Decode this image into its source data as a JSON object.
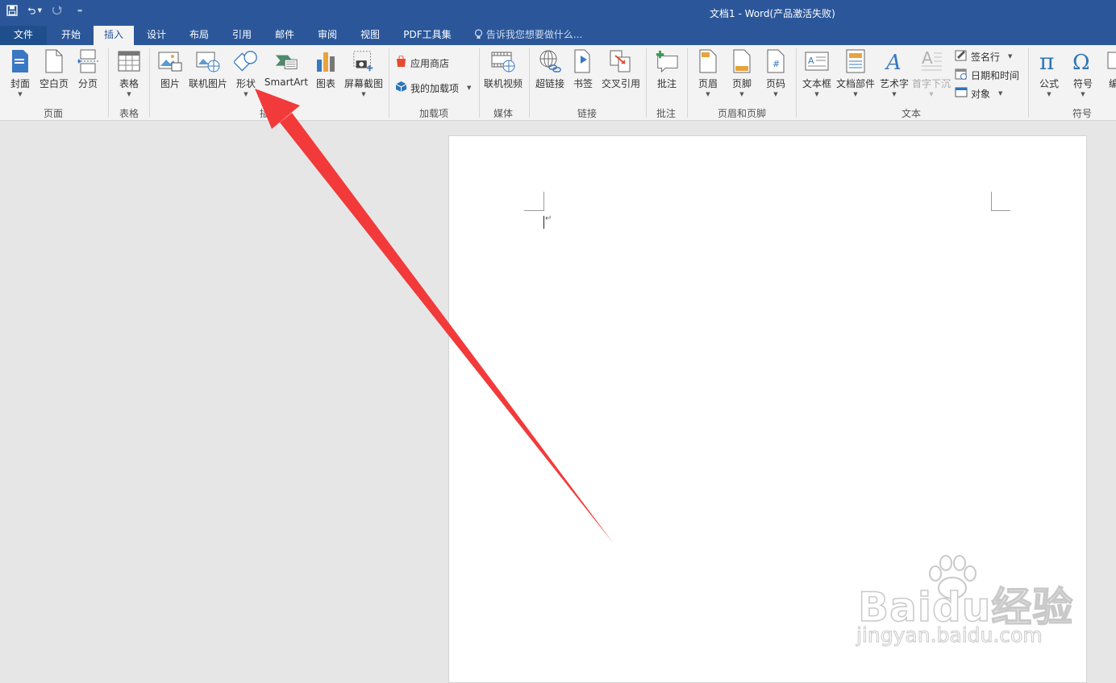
{
  "window": {
    "title": "文档1 - Word(产品激活失败)"
  },
  "qat": {
    "save_icon": "save-icon",
    "undo_icon": "undo-icon",
    "redo_icon": "redo-icon",
    "customize_icon": "customize-qat-icon"
  },
  "tabs": {
    "file": "文件",
    "home": "开始",
    "insert": "插入",
    "design": "设计",
    "layout": "布局",
    "references": "引用",
    "mailings": "邮件",
    "review": "审阅",
    "view": "视图",
    "pdf": "PDF工具集"
  },
  "tellme": {
    "placeholder": "告诉我您想要做什么..."
  },
  "ribbon": {
    "pages": {
      "cover": "封面",
      "blank": "空白页",
      "break": "分页",
      "group": "页面"
    },
    "tables": {
      "table": "表格",
      "group": "表格"
    },
    "illustrations": {
      "pictures": "图片",
      "online_pictures": "联机图片",
      "shapes": "形状",
      "smartart": "SmartArt",
      "chart": "图表",
      "screenshot": "屏幕截图",
      "group": "插图"
    },
    "addins": {
      "store": "应用商店",
      "my_addins": "我的加载项",
      "group": "加载项"
    },
    "media": {
      "online_video": "联机视频",
      "group": "媒体"
    },
    "links": {
      "hyperlink": "超链接",
      "bookmark": "书签",
      "crossref": "交叉引用",
      "group": "链接"
    },
    "comments": {
      "comment": "批注",
      "group": "批注"
    },
    "header_footer": {
      "header": "页眉",
      "footer": "页脚",
      "page_number": "页码",
      "group": "页眉和页脚"
    },
    "text": {
      "textbox": "文本框",
      "quickparts": "文档部件",
      "wordart": "艺术字",
      "dropcap": "首字下沉",
      "signature": "签名行",
      "datetime": "日期和时间",
      "object": "对象",
      "group": "文本"
    },
    "symbols": {
      "equation": "公式",
      "symbol": "符号",
      "more": "编",
      "group": "符号"
    }
  },
  "watermark": {
    "brand": "Baidu经验",
    "url": "jingyan.baidu.com"
  },
  "colors": {
    "accent": "#2b579a",
    "arrow": "#f23a3a"
  }
}
